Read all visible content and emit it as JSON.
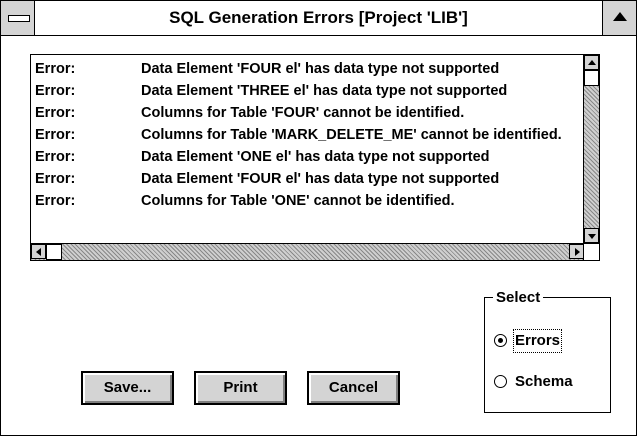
{
  "window": {
    "title": "SQL Generation Errors [Project 'LIB']"
  },
  "errors": [
    {
      "label": "Error:",
      "message": "Data Element 'FOUR el' has data type not supported"
    },
    {
      "label": "Error:",
      "message": "Data Element 'THREE el' has data type not supported"
    },
    {
      "label": "Error:",
      "message": "Columns for Table 'FOUR' cannot be identified."
    },
    {
      "label": "Error:",
      "message": "Columns for Table 'MARK_DELETE_ME' cannot be identified."
    },
    {
      "label": "Error:",
      "message": "Data Element 'ONE el' has data type not supported"
    },
    {
      "label": "Error:",
      "message": "Data Element 'FOUR el' has data type not supported"
    },
    {
      "label": "Error:",
      "message": "Columns for Table 'ONE' cannot be identified."
    }
  ],
  "select_group": {
    "title": "Select",
    "options": [
      {
        "label": "Errors",
        "selected": true
      },
      {
        "label": "Schema",
        "selected": false
      }
    ]
  },
  "buttons": {
    "save": "Save...",
    "print": "Print",
    "cancel": "Cancel"
  },
  "icons": {
    "system_menu": "system-menu-icon",
    "maximize": "maximize-icon"
  }
}
